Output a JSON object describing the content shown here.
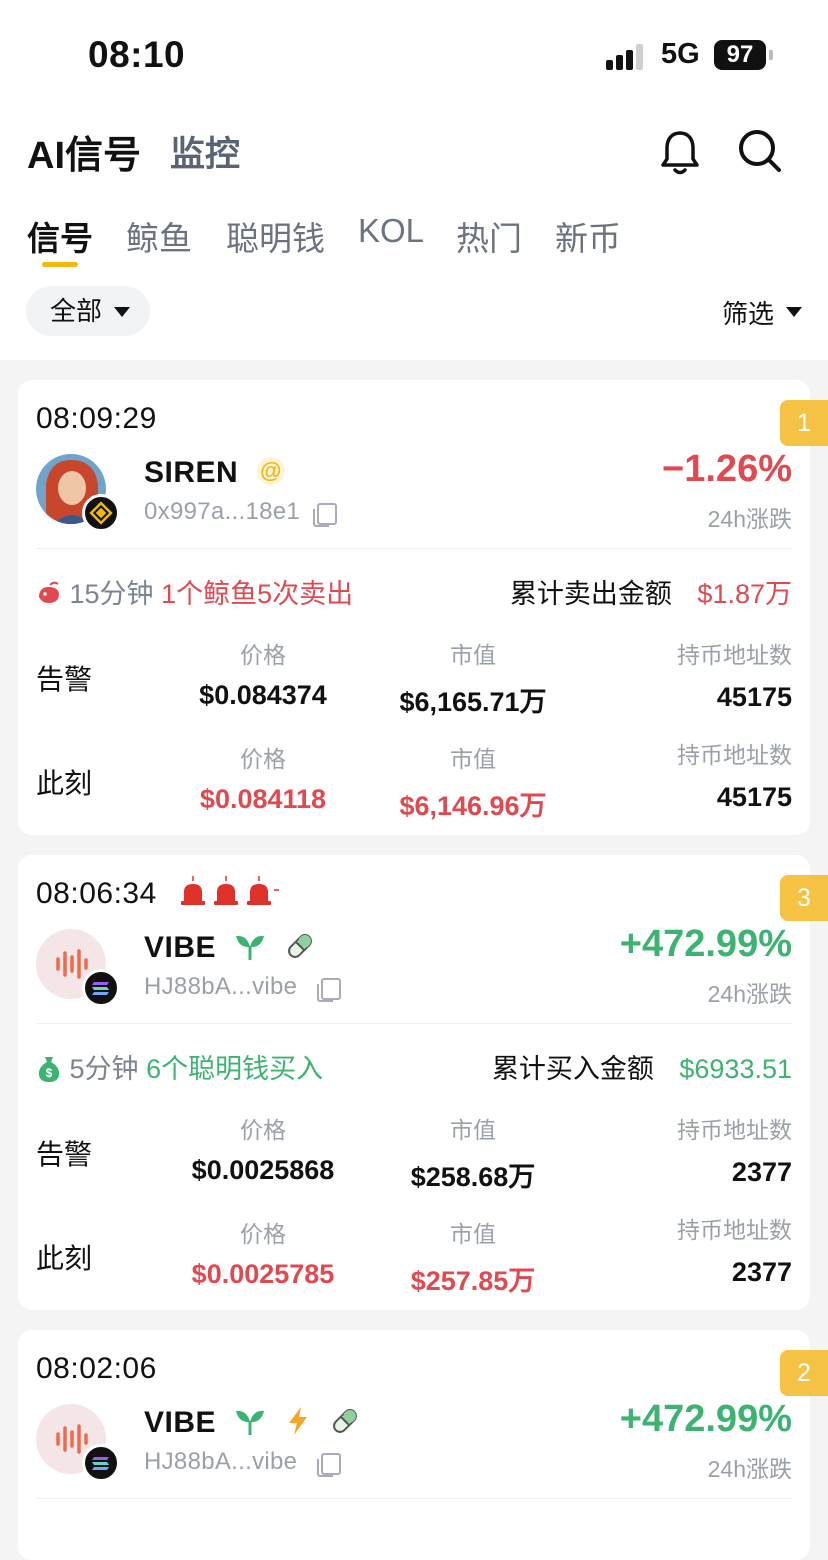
{
  "status_bar": {
    "time": "08:10",
    "network": "5G",
    "battery": "97"
  },
  "header": {
    "title": "AI信号",
    "subtitle": "监控"
  },
  "tabs": [
    {
      "label": "信号",
      "active": true
    },
    {
      "label": "鲸鱼"
    },
    {
      "label": "聪明钱"
    },
    {
      "label": "KOL"
    },
    {
      "label": "热门"
    },
    {
      "label": "新币"
    }
  ],
  "filters": {
    "category": "全部",
    "filter_label": "筛选"
  },
  "labels": {
    "change_24h": "24h涨跌",
    "alert": "告警",
    "now": "此刻",
    "price": "价格",
    "mcap": "市值",
    "holders": "持币地址数"
  },
  "colors": {
    "accent": "#f0b90b",
    "up": "#3cb371",
    "down": "#e0494f",
    "rank_badge": "#f6c244"
  },
  "cards": [
    {
      "time": "08:09:29",
      "rank": "1",
      "name": "SIREN",
      "address": "0x997a...18e1",
      "chain_icon": "bnb-chain-icon",
      "change": "−1.26%",
      "event_duration": "15分钟",
      "event_desc": "1个鲸鱼5次卖出",
      "sum_label": "累计卖出金额",
      "sum_value": "$1.87万",
      "alert": {
        "price": "$0.084374",
        "mcap": "$6,165.71万",
        "holders": "45175"
      },
      "now": {
        "price": "$0.084118",
        "mcap": "$6,146.96万",
        "holders": "45175"
      }
    },
    {
      "time": "08:06:34",
      "rank": "3",
      "name": "VIBE",
      "address": "HJ88bA...vibe",
      "chain_icon": "solana-chain-icon",
      "change": "+472.99%",
      "event_duration": "5分钟",
      "event_desc": "6个聪明钱买入",
      "sum_label": "累计买入金额",
      "sum_value": "$6933.51",
      "alert": {
        "price": "$0.0025868",
        "mcap": "$258.68万",
        "holders": "2377"
      },
      "now": {
        "price": "$0.0025785",
        "mcap": "$257.85万",
        "holders": "2377"
      }
    },
    {
      "time": "08:02:06",
      "rank": "2",
      "name": "VIBE",
      "address": "HJ88bA...vibe",
      "chain_icon": "solana-chain-icon",
      "change": "+472.99%"
    }
  ]
}
